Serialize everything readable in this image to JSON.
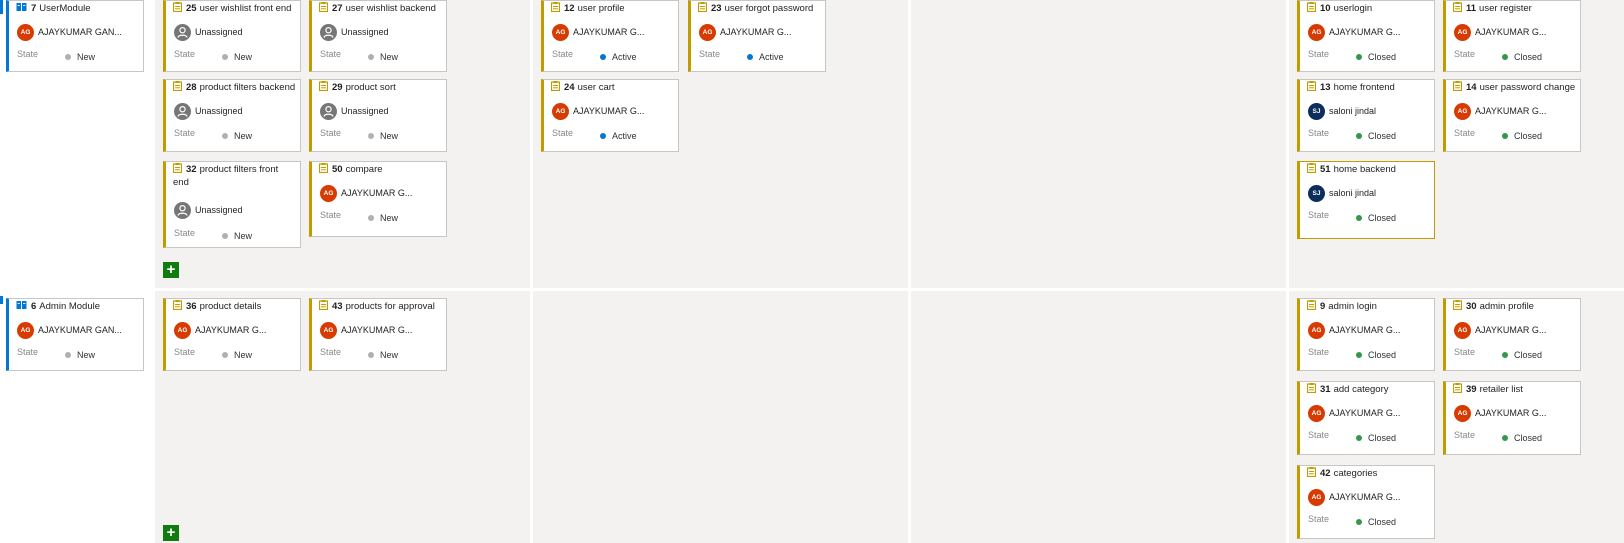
{
  "colors": {
    "accent": "#0078d4",
    "task": "#c19c00",
    "new": "#b2b0ae",
    "active": "#0078d4",
    "closed": "#339947",
    "add": "#107c10"
  },
  "labels": {
    "state": "State",
    "add": "+"
  },
  "rows": [
    {
      "parent": {
        "id": "7",
        "title": "UserModule",
        "assignee": "AJAYKUMAR GAN...",
        "initials": "AG",
        "state": "New",
        "icon": "book-icon"
      },
      "cards": [
        {
          "id": "25",
          "title": "user wishlist front end",
          "assignee": "Unassigned",
          "initials": "",
          "state": "New"
        },
        {
          "id": "27",
          "title": "user wishlist backend",
          "assignee": "Unassigned",
          "initials": "",
          "state": "New"
        },
        {
          "id": "28",
          "title": "product filters backend",
          "assignee": "Unassigned",
          "initials": "",
          "state": "New"
        },
        {
          "id": "29",
          "title": "product sort",
          "assignee": "Unassigned",
          "initials": "",
          "state": "New"
        },
        {
          "id": "32",
          "title": "product filters front end",
          "assignee": "Unassigned",
          "initials": "",
          "state": "New"
        },
        {
          "id": "50",
          "title": "compare",
          "assignee": "AJAYKUMAR G...",
          "initials": "AG",
          "state": "New"
        },
        {
          "id": "12",
          "title": "user profile",
          "assignee": "AJAYKUMAR G...",
          "initials": "AG",
          "state": "Active"
        },
        {
          "id": "23",
          "title": "user forgot password",
          "assignee": "AJAYKUMAR G...",
          "initials": "AG",
          "state": "Active"
        },
        {
          "id": "24",
          "title": "user cart",
          "assignee": "AJAYKUMAR G...",
          "initials": "AG",
          "state": "Active"
        },
        {
          "id": "10",
          "title": "userlogin",
          "assignee": "AJAYKUMAR G...",
          "initials": "AG",
          "state": "Closed"
        },
        {
          "id": "11",
          "title": "user register",
          "assignee": "AJAYKUMAR G...",
          "initials": "AG",
          "state": "Closed"
        },
        {
          "id": "13",
          "title": "home frontend",
          "assignee": "saloni jindal",
          "initials": "SJ",
          "state": "Closed"
        },
        {
          "id": "14",
          "title": "user password change",
          "assignee": "AJAYKUMAR G...",
          "initials": "AG",
          "state": "Closed"
        },
        {
          "id": "51",
          "title": "home backend",
          "assignee": "saloni jindal",
          "initials": "SJ",
          "state": "Closed"
        }
      ]
    },
    {
      "parent": {
        "id": "6",
        "title": "Admin Module",
        "assignee": "AJAYKUMAR GAN...",
        "initials": "AG",
        "state": "New",
        "icon": "book-icon"
      },
      "cards": [
        {
          "id": "36",
          "title": "product details",
          "assignee": "AJAYKUMAR G...",
          "initials": "AG",
          "state": "New"
        },
        {
          "id": "43",
          "title": "products for approval",
          "assignee": "AJAYKUMAR G...",
          "initials": "AG",
          "state": "New"
        },
        {
          "id": "9",
          "title": "admin login",
          "assignee": "AJAYKUMAR G...",
          "initials": "AG",
          "state": "Closed"
        },
        {
          "id": "30",
          "title": "admin profile",
          "assignee": "AJAYKUMAR G...",
          "initials": "AG",
          "state": "Closed"
        },
        {
          "id": "31",
          "title": "add category",
          "assignee": "AJAYKUMAR G...",
          "initials": "AG",
          "state": "Closed"
        },
        {
          "id": "39",
          "title": "retailer list",
          "assignee": "AJAYKUMAR G...",
          "initials": "AG",
          "state": "Closed"
        },
        {
          "id": "42",
          "title": "categories",
          "assignee": "AJAYKUMAR G...",
          "initials": "AG",
          "state": "Closed"
        }
      ]
    }
  ]
}
